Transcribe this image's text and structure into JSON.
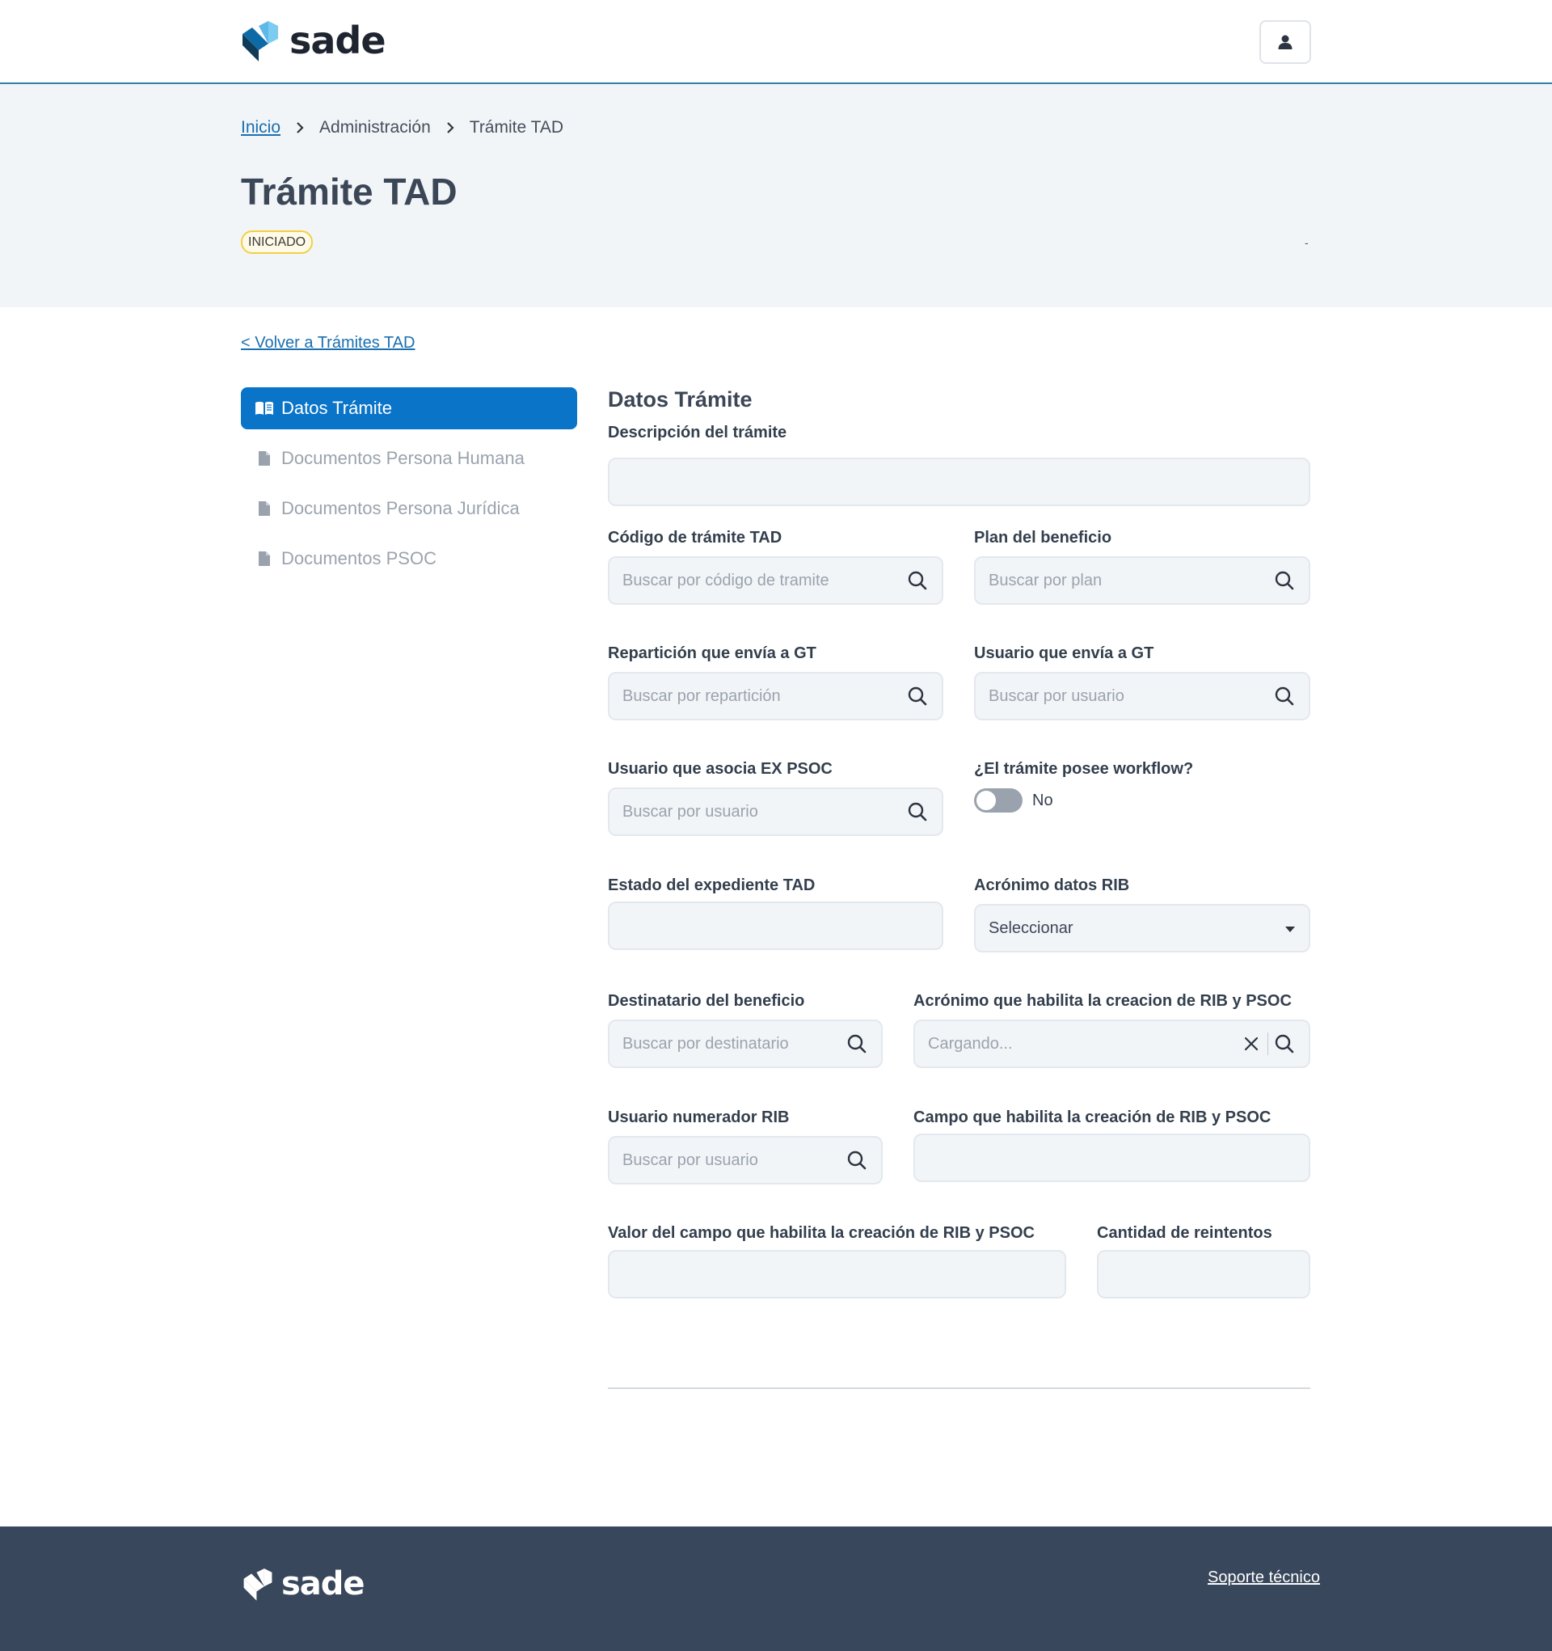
{
  "brand": {
    "name": "sade"
  },
  "header": {
    "user_icon": "user-icon"
  },
  "breadcrumb": {
    "items": [
      "Inicio",
      "Administración",
      "Trámite TAD"
    ]
  },
  "page": {
    "title": "Trámite TAD",
    "status": "INICIADO",
    "meta": "-"
  },
  "back_link": "< Volver a Trámites TAD",
  "sidebar": {
    "items": [
      {
        "label": "Datos Trámite",
        "icon": "book-open-icon",
        "active": true
      },
      {
        "label": "Documentos Persona Humana",
        "icon": "file-icon"
      },
      {
        "label": "Documentos Persona Jurídica",
        "icon": "file-icon"
      },
      {
        "label": "Documentos PSOC",
        "icon": "file-icon"
      }
    ]
  },
  "form": {
    "section_title": "Datos Trámite",
    "descripcion": {
      "label": "Descripción del trámite",
      "value": ""
    },
    "codigo": {
      "label": "Código de trámite TAD",
      "placeholder": "Buscar por código de tramite"
    },
    "plan": {
      "label": "Plan del beneficio",
      "placeholder": "Buscar por plan"
    },
    "reparticion": {
      "label": "Repartición que envía a GT",
      "placeholder": "Buscar por repartición"
    },
    "usuario_gt": {
      "label": "Usuario que envía a GT",
      "placeholder": "Buscar por usuario"
    },
    "usuario_psoc": {
      "label": "Usuario que asocia EX PSOC",
      "placeholder": "Buscar por usuario"
    },
    "workflow": {
      "label": "¿El trámite posee workflow?",
      "value": "No"
    },
    "estado": {
      "label": "Estado del expediente TAD",
      "value": ""
    },
    "acronimo_rib": {
      "label": "Acrónimo datos RIB",
      "selected": "Seleccionar"
    },
    "destinatario": {
      "label": "Destinatario del beneficio",
      "placeholder": "Buscar por destinatario"
    },
    "acronimo_habilita": {
      "label": "Acrónimo que habilita la creacion de RIB y PSOC",
      "placeholder": "Cargando..."
    },
    "usuario_rib": {
      "label": "Usuario numerador RIB",
      "placeholder": "Buscar por usuario"
    },
    "campo_habilita": {
      "label": "Campo que habilita la creación de RIB y PSOC",
      "value": ""
    },
    "valor_campo": {
      "label": "Valor del campo que habilita la creación de RIB y PSOC",
      "value": ""
    },
    "reintentos": {
      "label": "Cantidad de reintentos",
      "value": ""
    }
  },
  "footer": {
    "support_link": "Soporte técnico"
  },
  "colors": {
    "accent": "#0a74c9",
    "footer_bg": "#38475b",
    "hero_bg": "#f2f5f8",
    "badge_border": "#f2d044"
  }
}
